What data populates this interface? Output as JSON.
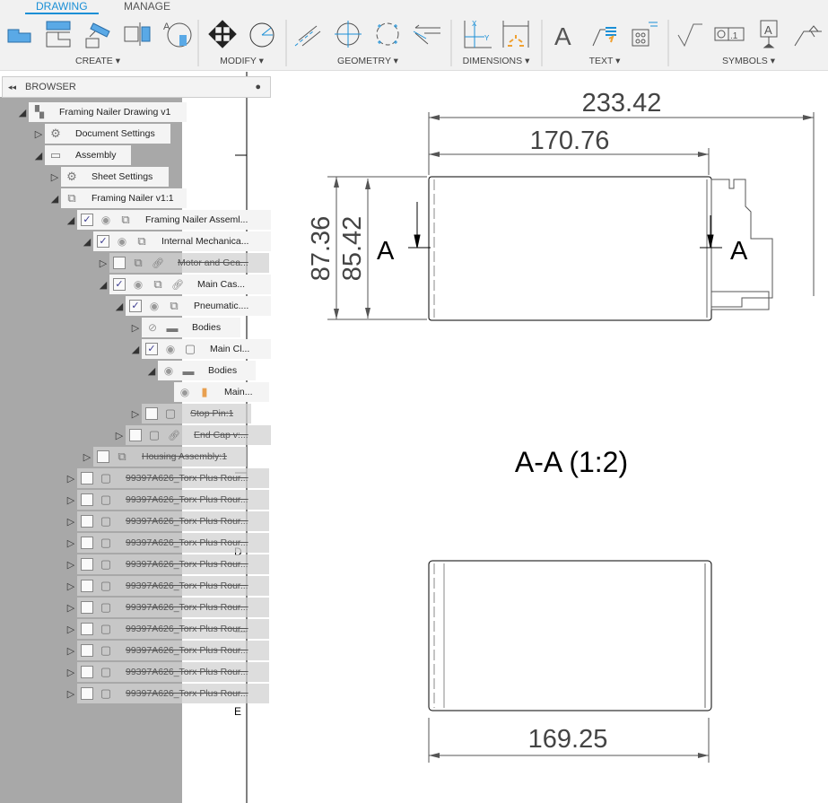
{
  "tabs": {
    "drawing": "DRAWING",
    "manage": "MANAGE"
  },
  "groups": {
    "create": "CREATE ▾",
    "modify": "MODIFY ▾",
    "geometry": "GEOMETRY ▾",
    "dimensions": "DIMENSIONS ▾",
    "text": "TEXT ▾",
    "symbols": "SYMBOLS ▾"
  },
  "accent": "#1a8fd6",
  "browser": {
    "title": "BROWSER",
    "collapse": "◂◂",
    "minimize": "●",
    "rows": [
      {
        "label": "Framing Nailer Drawing v1",
        "expand": "open",
        "icon": "drawing-icon"
      },
      {
        "label": "Document Settings",
        "expand": "closed",
        "icon": "gear-icon"
      },
      {
        "label": "Assembly",
        "expand": "open",
        "icon": "sheet-icon"
      },
      {
        "label": "Sheet Settings",
        "expand": "closed",
        "icon": "gear-icon"
      },
      {
        "label": "Framing Nailer v1:1",
        "expand": "open",
        "icon": "component-icon"
      },
      {
        "label": "Framing Nailer Asseml...",
        "expand": "open",
        "checked": true,
        "visible": true,
        "icon": "component-icon"
      },
      {
        "label": "Internal Mechanica...",
        "expand": "open",
        "checked": true,
        "visible": true,
        "icon": "component-icon"
      },
      {
        "label": "Motor and Gea...",
        "expand": "closed",
        "checked": false,
        "icon": "component-icon",
        "linked": true
      },
      {
        "label": "Main Cas...",
        "expand": "open",
        "checked": true,
        "visible": true,
        "icon": "component-icon",
        "linked": true
      },
      {
        "label": "Pneumatic....",
        "expand": "open",
        "checked": true,
        "visible": true,
        "icon": "component-icon"
      },
      {
        "label": "Bodies",
        "expand": "closed",
        "visible": false,
        "icon": "folder-icon"
      },
      {
        "label": "Main Cl...",
        "expand": "open",
        "checked": true,
        "visible": true,
        "icon": "body-icon"
      },
      {
        "label": "Bodies",
        "expand": "open",
        "visible": true,
        "icon": "folder-icon"
      },
      {
        "label": "Main...",
        "expand": "none",
        "visible": true,
        "icon": "solid-body-icon"
      },
      {
        "label": "Stop Pin:1",
        "expand": "closed",
        "checked": false,
        "icon": "body-icon"
      },
      {
        "label": "End Cap v:...",
        "expand": "closed",
        "checked": false,
        "icon": "body-icon",
        "linked": true
      },
      {
        "label": "Housing Assembly:1",
        "expand": "closed",
        "checked": false,
        "icon": "component-icon"
      },
      {
        "label": "99397A626_Torx Plus Rour...",
        "expand": "closed",
        "checked": false,
        "icon": "body-icon"
      },
      {
        "label": "99397A626_Torx Plus Rour...",
        "expand": "closed",
        "checked": false,
        "icon": "body-icon"
      },
      {
        "label": "99397A626_Torx Plus Rour...",
        "expand": "closed",
        "checked": false,
        "icon": "body-icon"
      },
      {
        "label": "99397A626_Torx Plus Rour...",
        "expand": "closed",
        "checked": false,
        "icon": "body-icon"
      },
      {
        "label": "99397A626_Torx Plus Rour...",
        "expand": "closed",
        "checked": false,
        "icon": "body-icon"
      },
      {
        "label": "99397A626_Torx Plus Rour...",
        "expand": "closed",
        "checked": false,
        "icon": "body-icon"
      },
      {
        "label": "99397A626_Torx Plus Rour...",
        "expand": "closed",
        "checked": false,
        "icon": "body-icon"
      },
      {
        "label": "99397A626_Torx Plus Rour...",
        "expand": "closed",
        "checked": false,
        "icon": "body-icon"
      },
      {
        "label": "99397A626_Torx Plus Rour...",
        "expand": "closed",
        "checked": false,
        "icon": "body-icon"
      },
      {
        "label": "99397A626_Torx Plus Rour...",
        "expand": "closed",
        "checked": false,
        "icon": "body-icon"
      },
      {
        "label": "99397A626_Torx Plus Rour...",
        "expand": "closed",
        "checked": false,
        "icon": "body-icon"
      }
    ]
  },
  "drawing": {
    "dims": {
      "overall_length": "233.42",
      "body_length": "170.76",
      "overall_height": "87.36",
      "body_height": "85.42",
      "section_length": "169.25"
    },
    "section_marker": "A",
    "section_title": "A-A (1:2)",
    "zone_labels": {
      "d": "D",
      "e": "E"
    }
  }
}
